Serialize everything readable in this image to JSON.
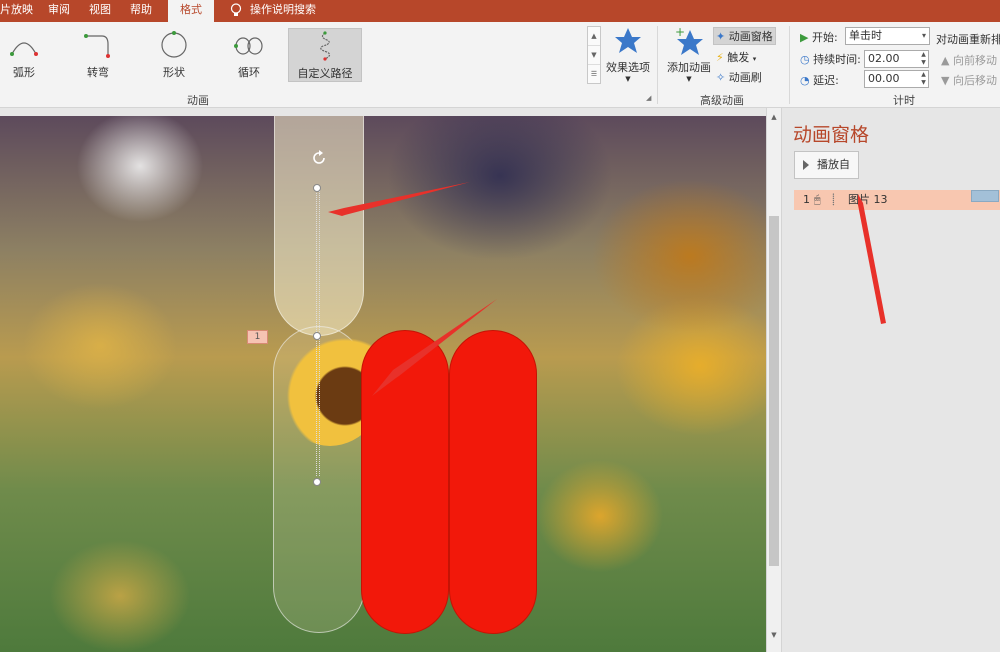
{
  "tabs": [
    {
      "label": "片放映",
      "active": false
    },
    {
      "label": "审阅",
      "active": false
    },
    {
      "label": "视图",
      "active": false
    },
    {
      "label": "帮助",
      "active": false
    },
    {
      "label": "格式",
      "active": true
    }
  ],
  "tell_me": "操作说明搜索",
  "ribbon": {
    "motion_paths": [
      {
        "label": "弧形",
        "icon": "arc-path-icon"
      },
      {
        "label": "转弯",
        "icon": "turn-path-icon"
      },
      {
        "label": "形状",
        "icon": "shape-path-icon"
      },
      {
        "label": "循环",
        "icon": "loop-path-icon"
      },
      {
        "label": "自定义路径",
        "icon": "custom-path-icon"
      }
    ],
    "effect_options": "效果选项",
    "animation_group": "动画",
    "add_animation": "添加动画",
    "animation_pane_btn": "动画窗格",
    "trigger": "触发",
    "animation_painter": "动画刷",
    "advanced_group": "高级动画",
    "start_label": "开始:",
    "start_value": "单击时",
    "duration_label": "持续时间:",
    "duration_value": "02.00",
    "delay_label": "延迟:",
    "delay_value": "00.00",
    "reorder_label": "对动画重新排",
    "move_earlier": "向前移动",
    "move_later": "向后移动",
    "timing_group": "计时"
  },
  "slide": {
    "badge": "1"
  },
  "pane": {
    "title": "动画窗格",
    "play_from": "播放自",
    "items": [
      {
        "index": "1",
        "name": "图片 13"
      }
    ]
  },
  "colors": {
    "accent": "#b7472a",
    "pill_red": "#f2180a",
    "arrow_red": "#e8312a",
    "selected_row": "#f8c7b0"
  }
}
